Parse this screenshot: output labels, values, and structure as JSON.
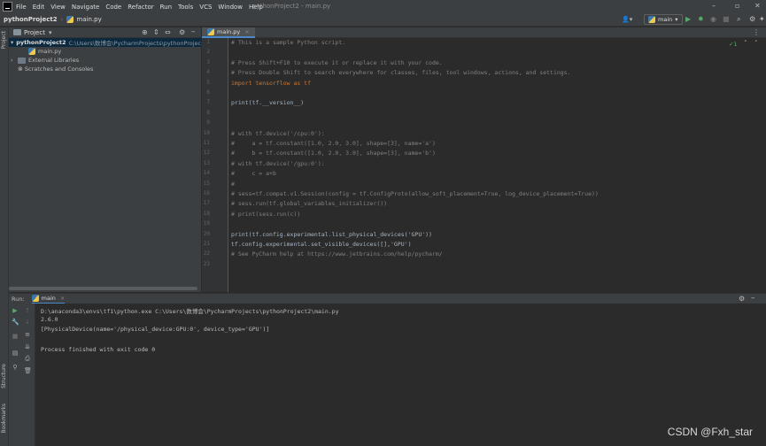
{
  "menu": [
    "File",
    "Edit",
    "View",
    "Navigate",
    "Code",
    "Refactor",
    "Run",
    "Tools",
    "VCS",
    "Window",
    "Help"
  ],
  "window_title": "pythonProject2 - main.py",
  "nav": {
    "project": "pythonProject2",
    "file": "main.py",
    "run_config": "main"
  },
  "project_panel": {
    "title": "Project",
    "root_name": "pythonProject2",
    "root_path": "C:\\Users\\数博会\\PycharmProjects\\pythonProject2",
    "file": "main.py",
    "external": "External Libraries",
    "scratches": "Scratches and Consoles"
  },
  "editor": {
    "tab": "main.py",
    "inspection_count": "1",
    "lines": [
      {
        "n": "1",
        "t": "# This is a sample Python script."
      },
      {
        "n": "2",
        "t": ""
      },
      {
        "n": "3",
        "t": "# Press Shift+F10 to execute it or replace it with your code."
      },
      {
        "n": "4",
        "t": "# Press Double Shift to search everywhere for classes, files, tool windows, actions, and settings."
      },
      {
        "n": "5",
        "t": "import tensorflow as tf"
      },
      {
        "n": "6",
        "t": ""
      },
      {
        "n": "7",
        "t": "print(tf.__version__)"
      },
      {
        "n": "8",
        "t": ""
      },
      {
        "n": "9",
        "t": ""
      },
      {
        "n": "10",
        "t": "# with tf.device('/cpu:0'):"
      },
      {
        "n": "11",
        "t": "#     a = tf.constant([1.0, 2.0, 3.0], shape=[3], name='a')"
      },
      {
        "n": "12",
        "t": "#     b = tf.constant([1.0, 2.0, 3.0], shape=[3], name='b')"
      },
      {
        "n": "13",
        "t": "# with tf.device('/gpu:0'):"
      },
      {
        "n": "14",
        "t": "#     c = a+b"
      },
      {
        "n": "15",
        "t": "#"
      },
      {
        "n": "16",
        "t": "# sess=tf.compat.v1.Session(config = tf.ConfigProto(allow_soft_placement=True, log_device_placement=True))"
      },
      {
        "n": "17",
        "t": "# sess.run(tf.global_variables_initializer())"
      },
      {
        "n": "18",
        "t": "# print(sess.run(c))"
      },
      {
        "n": "19",
        "t": ""
      },
      {
        "n": "20",
        "t": "print(tf.config.experimental.list_physical_devices('GPU'))"
      },
      {
        "n": "21",
        "t": "tf.config.experimental.set_visible_devices([],'GPU')"
      },
      {
        "n": "22",
        "t": "# See PyCharm help at https://www.jetbrains.com/help/pycharm/"
      },
      {
        "n": "23",
        "t": ""
      }
    ]
  },
  "run": {
    "label": "Run:",
    "tab": "main",
    "output": [
      "D:\\anaconda3\\envs\\tf1\\python.exe C:\\Users\\数博会\\PycharmProjects\\pythonProject2\\main.py",
      "2.6.0",
      "[PhysicalDevice(name='/physical_device:GPU:0', device_type='GPU')]",
      "",
      "Process finished with exit code 0"
    ]
  },
  "side_tabs": {
    "project": "Project",
    "structure": "Structure",
    "bookmarks": "Bookmarks"
  },
  "watermark": "CSDN @Fxh_star"
}
